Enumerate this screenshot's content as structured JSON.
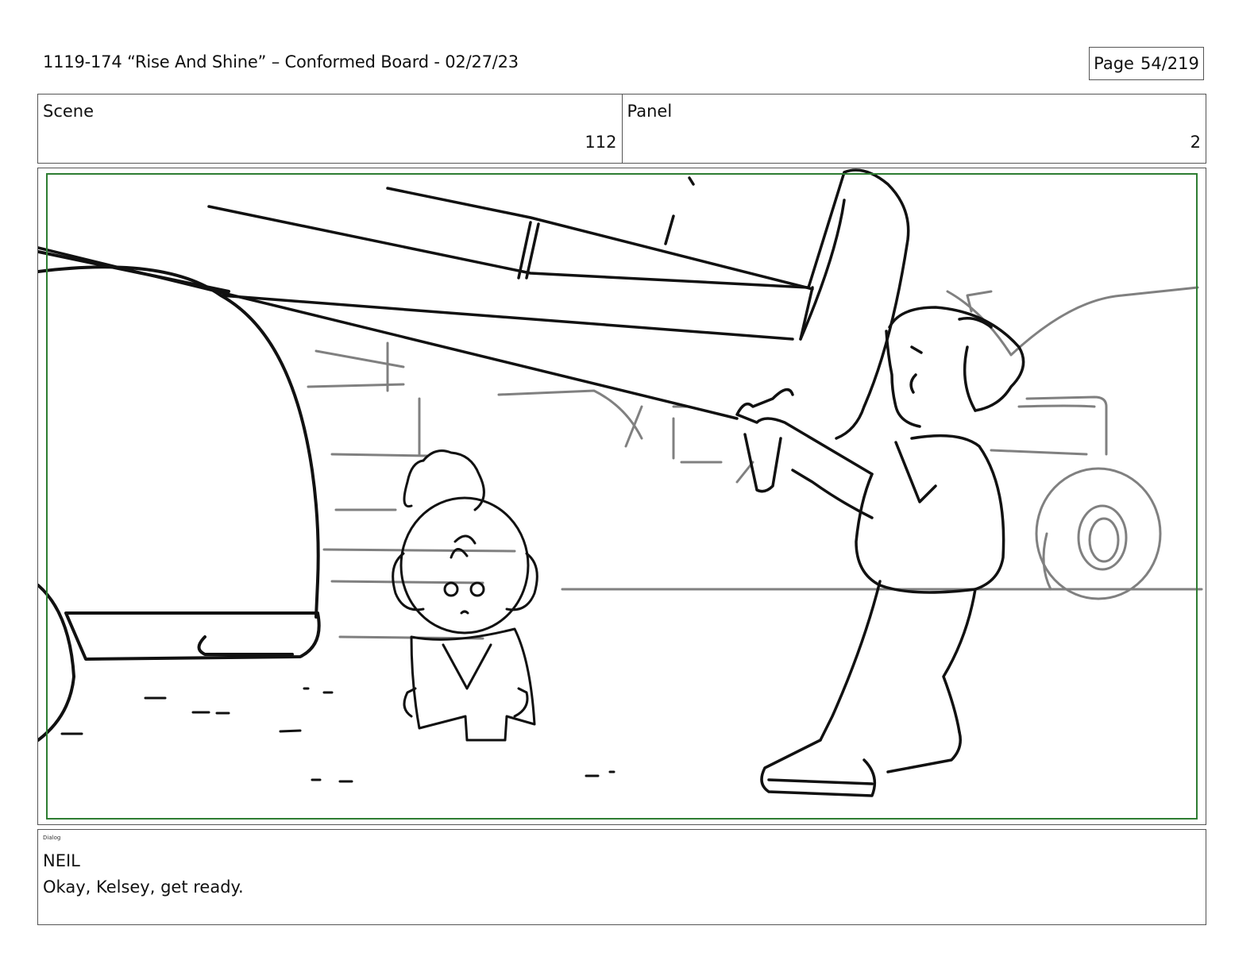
{
  "header": {
    "title": "1119-174 “Rise And Shine” – Conformed Board - 02/27/23",
    "page_label": "Page",
    "page_number": "54/219"
  },
  "scene": {
    "label": "Scene",
    "value": "112"
  },
  "panel": {
    "label": "Panel",
    "value": "2"
  },
  "drawing": {
    "safe_frame_color": "#2e7d32",
    "line_color": "#111111",
    "background_line_color": "#808080"
  },
  "dialog": {
    "label": "Dialog",
    "speaker": "NEIL",
    "line": "Okay, Kelsey, get ready."
  }
}
